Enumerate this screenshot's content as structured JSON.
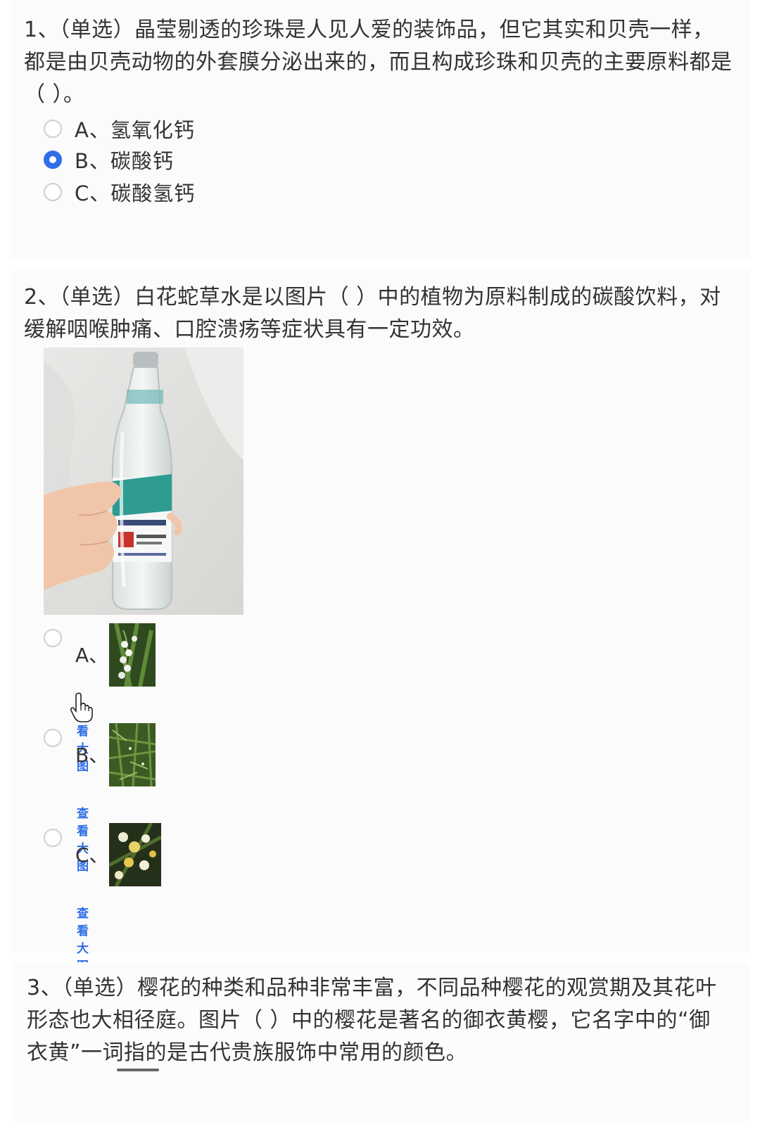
{
  "questions": [
    {
      "text": "1、（单选）晶莹剔透的珍珠是人见人爱的装饰品，但它其实和贝壳一样，都是由贝壳动物的外套膜分泌出来的，而且构成珍珠和贝壳的主要原料都是（ ）。",
      "options": [
        {
          "label": "A、氢氧化钙",
          "selected": false
        },
        {
          "label": "B、碳酸钙",
          "selected": true
        },
        {
          "label": "C、碳酸氢钙",
          "selected": false
        }
      ]
    },
    {
      "text": "2、（单选）白花蛇草水是以图片（ ）中的植物为原料制成的碳酸饮料，对缓解咽喉肿痛、口腔溃疡等症状具有一定功效。",
      "options": [
        {
          "label": "A、",
          "link": "查看大图",
          "selected": false
        },
        {
          "label": "B、",
          "link": "查看大图",
          "selected": false
        },
        {
          "label": "C、",
          "link": "查看大图",
          "selected": false
        }
      ]
    },
    {
      "text": "3、（单选）樱花的种类和品种非常丰富，不同品种樱花的观赏期及其花叶形态也大相径庭。图片（ ）中的樱花是著名的御衣黄樱，它名字中的“御衣黄”一词指的是古代贵族服饰中常用的颜色。"
    }
  ],
  "colors": {
    "accent": "#2f6ee8",
    "text": "#333333",
    "radio_border": "#cfcfcf"
  }
}
